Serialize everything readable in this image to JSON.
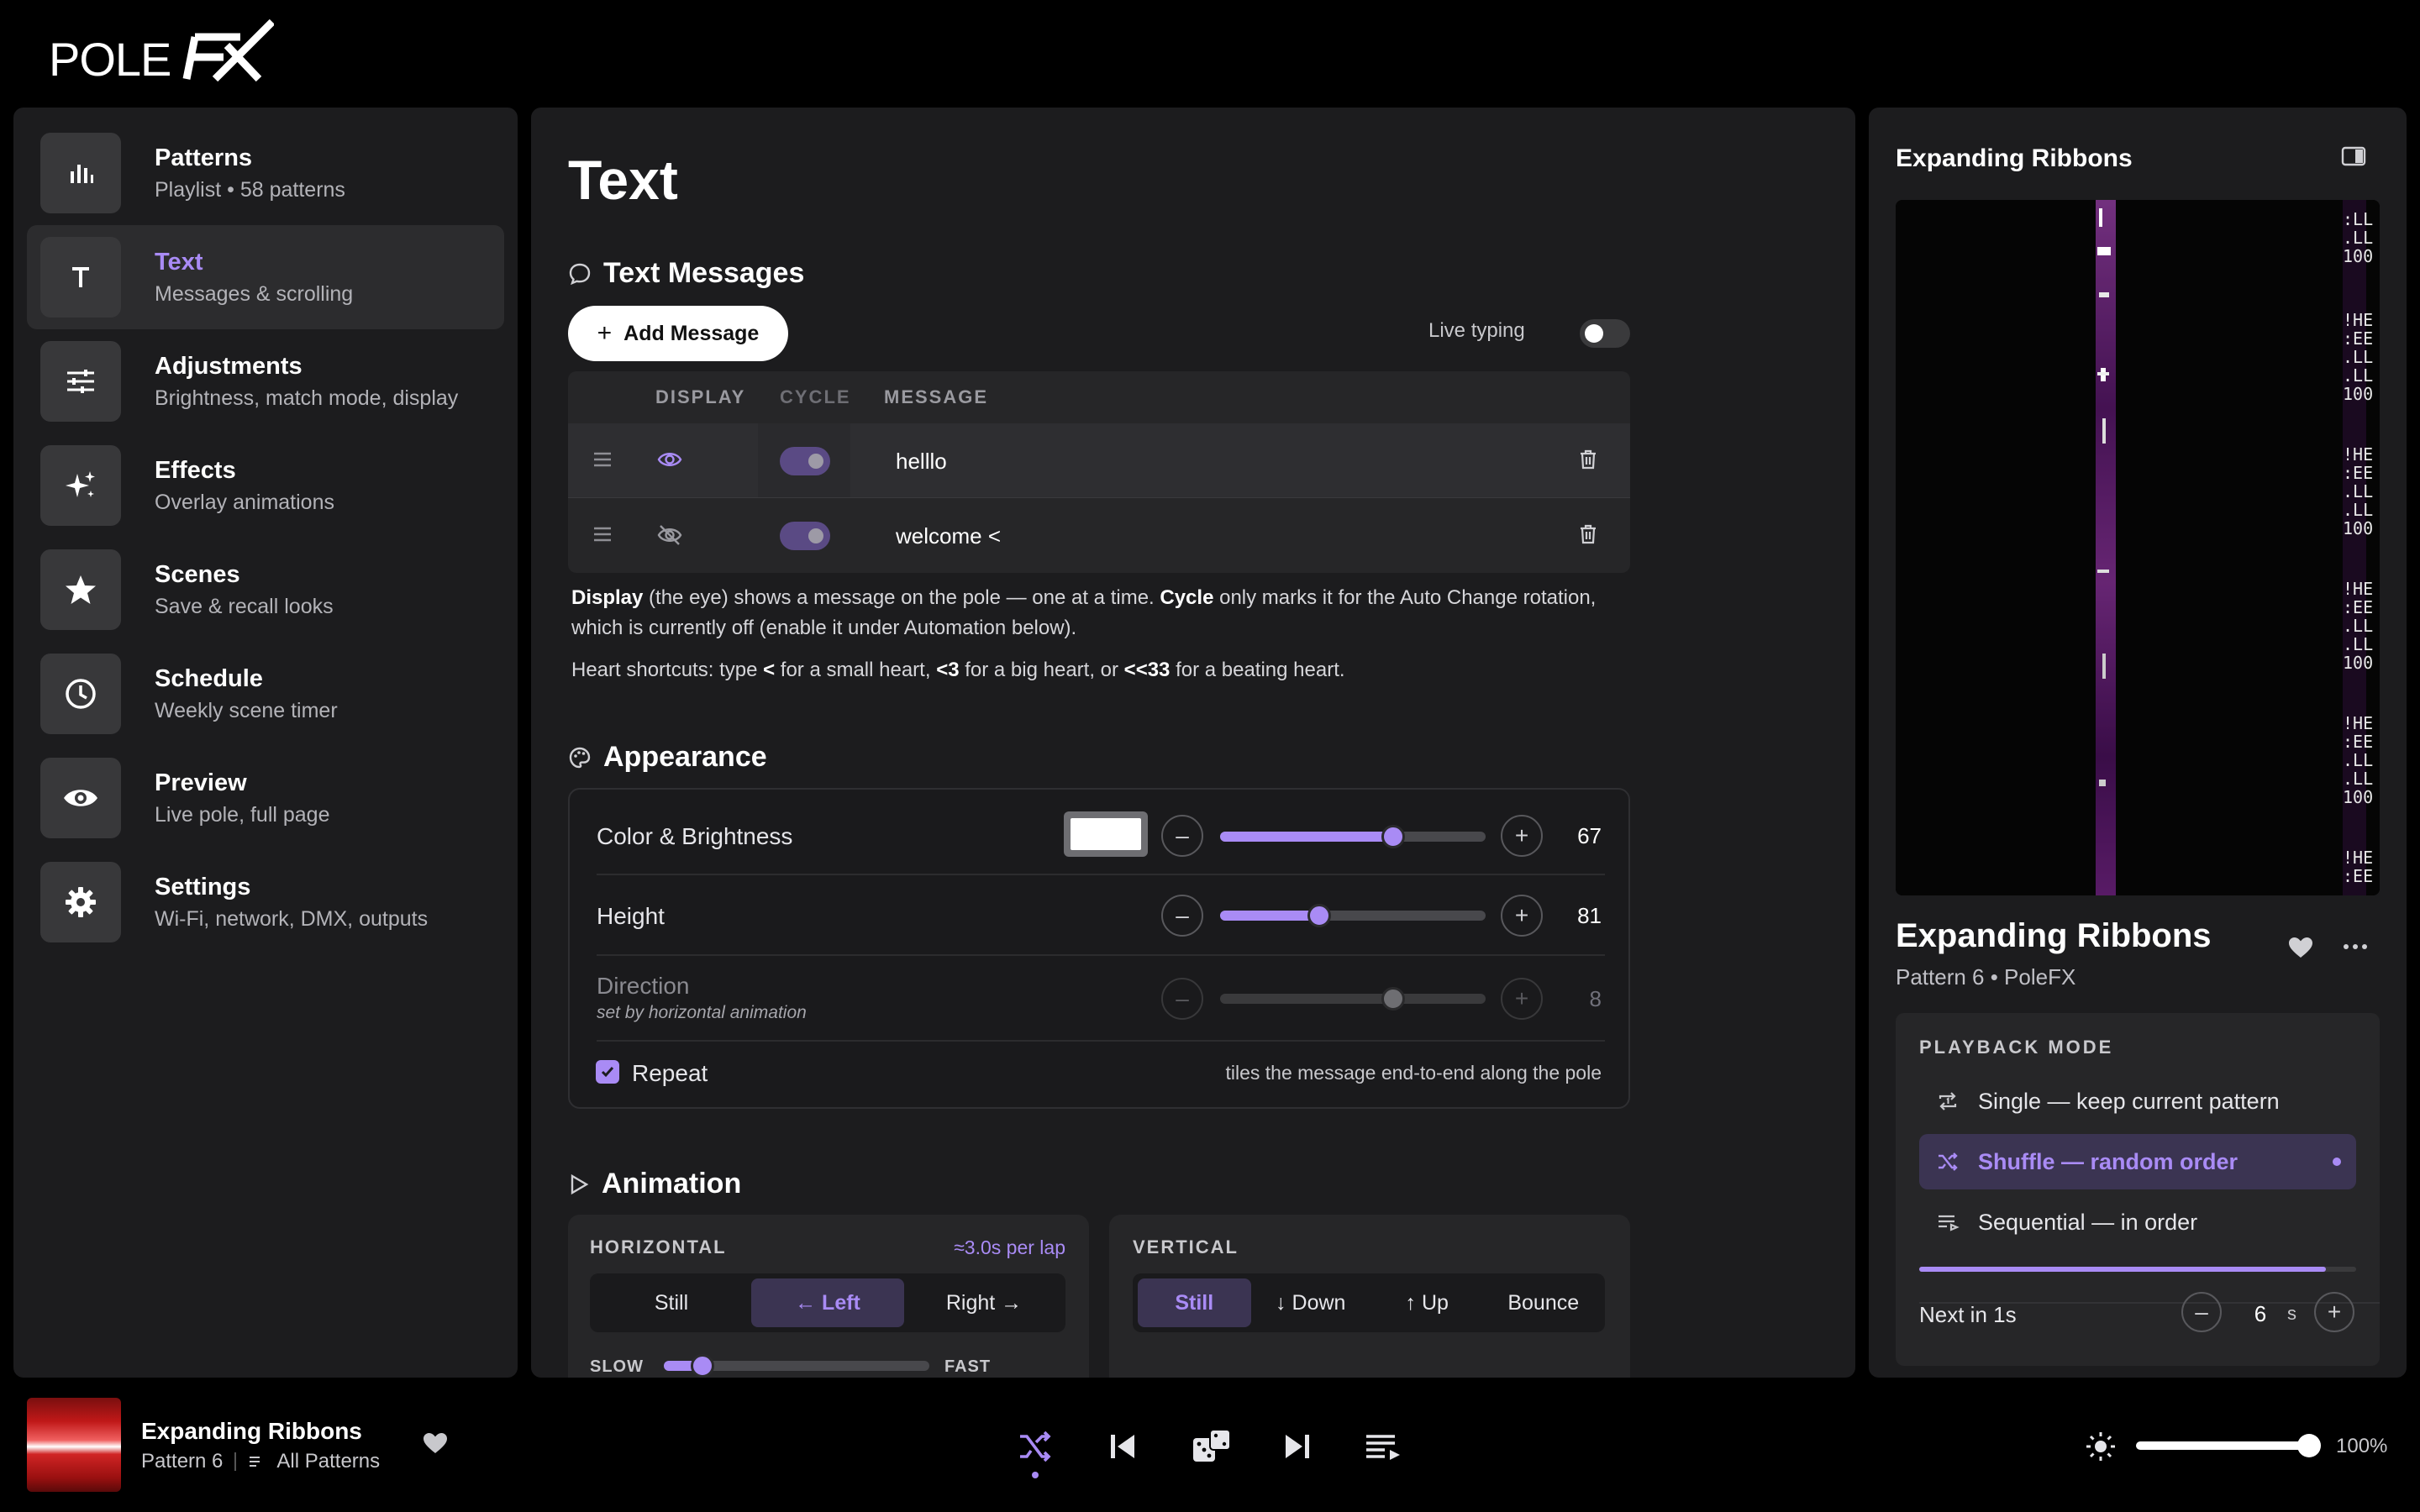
{
  "brand": {
    "logo_text": "POLEFX"
  },
  "sidebar": {
    "items": [
      {
        "title": "Patterns",
        "subtitle": "Playlist • 58 patterns",
        "icon": "bars-chart-icon"
      },
      {
        "title": "Text",
        "subtitle": "Messages & scrolling",
        "icon": "text-t-icon",
        "active": true
      },
      {
        "title": "Adjustments",
        "subtitle": "Brightness, match mode, display",
        "icon": "sliders-icon"
      },
      {
        "title": "Effects",
        "subtitle": "Overlay animations",
        "icon": "sparkles-icon"
      },
      {
        "title": "Scenes",
        "subtitle": "Save & recall looks",
        "icon": "star-icon"
      },
      {
        "title": "Schedule",
        "subtitle": "Weekly scene timer",
        "icon": "clock-icon"
      },
      {
        "title": "Preview",
        "subtitle": "Live pole, full page",
        "icon": "eye-icon"
      },
      {
        "title": "Settings",
        "subtitle": "Wi-Fi, network, DMX, outputs",
        "icon": "gear-icon"
      }
    ]
  },
  "main": {
    "page_title": "Text",
    "text_messages": {
      "heading": "Text Messages",
      "add_button": "Add Message",
      "live_typing_label": "Live typing",
      "live_typing_on": false,
      "columns": [
        "DISPLAY",
        "CYCLE",
        "MESSAGE"
      ],
      "rows": [
        {
          "message": "helllo",
          "display": true,
          "cycle": true
        },
        {
          "message": "welcome <",
          "display": false,
          "cycle": true
        }
      ],
      "note1": {
        "display_bold": "Display",
        "display_rest": " (the eye) shows a message on the pole — one at a time. ",
        "cycle_bold": "Cycle",
        "cycle_rest": " only marks it for the Auto Change rotation, which is currently off (enable it under Automation below)."
      },
      "note2": {
        "p1": "Heart shortcuts: type ",
        "k1": "<",
        "p2": " for a small heart, ",
        "k2": "<3",
        "p3": " for a big heart, or ",
        "k3": "<<33",
        "p4": " for a beating heart."
      }
    },
    "appearance": {
      "heading": "Appearance",
      "color_brightness": {
        "label": "Color & Brightness",
        "value": "67",
        "color": "#ffffff"
      },
      "height": {
        "label": "Height",
        "value": "81"
      },
      "direction": {
        "label": "Direction",
        "sublabel": "set by horizontal animation",
        "value": "8"
      },
      "repeat": {
        "label": "Repeat",
        "checked": true,
        "hint": "tiles the message end-to-end along the pole"
      }
    },
    "animation": {
      "heading": "Animation",
      "horizontal": {
        "label": "HORIZONTAL",
        "lap_info": "≈3.0s per lap",
        "options": [
          "Still",
          "← Left",
          "Right →"
        ],
        "selected": "← Left",
        "speed_slow": "SLOW",
        "speed_fast": "FAST",
        "speed_level": 0.15
      },
      "vertical": {
        "label": "VERTICAL",
        "options": [
          "Still",
          "↓ Down",
          "↑ Up",
          "Bounce"
        ],
        "selected": "Still"
      }
    }
  },
  "right_panel": {
    "header_title": "Expanding Ribbons",
    "now_playing": {
      "title": "Expanding Ribbons",
      "subtitle": "Pattern 6 • PoleFX"
    },
    "playback_mode": {
      "label": "PLAYBACK MODE",
      "options": [
        "Single — keep current pattern",
        "Shuffle — random order",
        "Sequential — in order"
      ],
      "selected": "Shuffle — random order",
      "progress": 0.93,
      "next_label": "Next in 1s",
      "interval": "6",
      "unit": "s"
    }
  },
  "bottom_bar": {
    "title": "Expanding Ribbons",
    "pattern": "Pattern 6",
    "playlist": "All Patterns",
    "brightness": "100%",
    "brightness_level": 1.0
  },
  "colors": {
    "accent": "#a98bf5",
    "panel": "#1c1c1e",
    "background": "#000000"
  }
}
